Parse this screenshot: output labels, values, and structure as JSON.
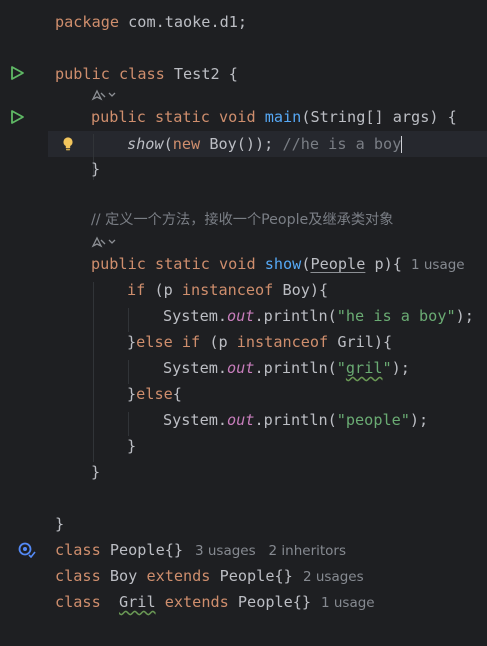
{
  "editor": {
    "line_package": {
      "kw": "package",
      "rest": " com.taoke.d1;"
    },
    "line_class": {
      "kw1": "public",
      "kw2": "class",
      "rest": " Test2 {"
    },
    "line_main": {
      "kw": "public static void",
      "fn": "main",
      "rest": "(String[] args) {"
    },
    "line_show_call": {
      "call": "show",
      "p1": "(",
      "kw": "new",
      "rest": " Boy()); ",
      "comment": "//he is a boy"
    },
    "line_close_main": "}",
    "line_comment": "// 定义一个方法，接收一个People及继承类对象",
    "line_show_decl": {
      "kw": "public static void",
      "fn": "show",
      "p1": "(",
      "type": "People",
      "rest": " p){"
    },
    "line_show_decl_hint": "1 usage",
    "line_if": {
      "kw": "if",
      "p1": " (p ",
      "kw2": "instanceof",
      "rest": " Boy){"
    },
    "line_print1": {
      "pre": "System.",
      "fld": "out",
      "mid": ".println(",
      "str": "\"he is a boy\"",
      "end": ");"
    },
    "line_elseif": {
      "pre": "}",
      "kw": "else if",
      "p1": " (p ",
      "kw2": "instanceof",
      "rest": " Gril){"
    },
    "line_print2": {
      "pre": "System.",
      "fld": "out",
      "mid": ".println(",
      "str_q1": "\"",
      "str_word": "gril",
      "str_q2": "\"",
      "end": ");"
    },
    "line_else": {
      "pre": "}",
      "kw": "else",
      "rest": "{"
    },
    "line_print3": {
      "pre": "System.",
      "fld": "out",
      "mid": ".println(",
      "str": "\"people\"",
      "end": ");"
    },
    "line_close_if": "}",
    "line_close_show": "}",
    "line_close_class": "}",
    "line_people": {
      "kw": "class",
      "rest": " People{}",
      "hint": "3 usages   2 inheritors"
    },
    "line_boy": {
      "kw": "class",
      "name": " Boy ",
      "kw2": "extends",
      "rest": " People{}",
      "hint": "2 usages"
    },
    "line_gril": {
      "kw": "class",
      "sp": "  ",
      "name": "Gril",
      "sp2": " ",
      "kw2": "extends",
      "rest": " People{}",
      "hint": "1 usage"
    }
  },
  "icons": {
    "run_class": "run-icon",
    "run_main": "run-icon",
    "intention": "lightbulb-icon",
    "implemented": "implemented-icon",
    "ai_hint": "ai-assistant-icon"
  },
  "colors": {
    "background": "#1e1f22",
    "keyword": "#cf8e6d",
    "function": "#56a8f5",
    "string": "#6aab73",
    "comment": "#7a7e85",
    "field": "#c77dbb",
    "run": "#5fb865"
  }
}
